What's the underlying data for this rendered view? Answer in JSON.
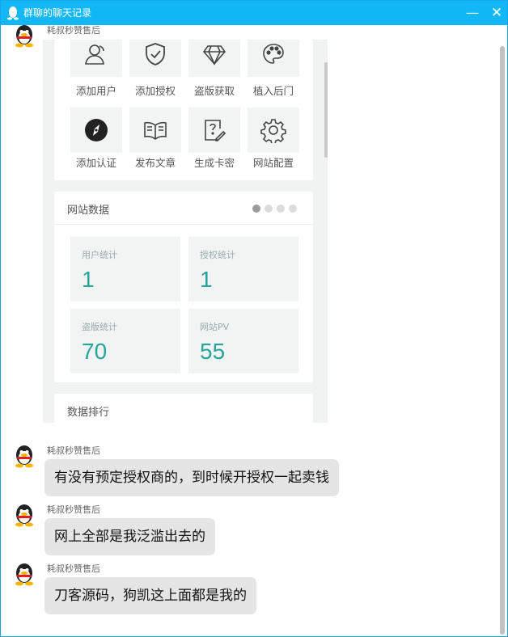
{
  "window": {
    "title": "群聊的聊天记录",
    "minimize": "—",
    "close": "✕"
  },
  "messages": [
    {
      "sender": "耗叔秒赞售后",
      "type": "image"
    },
    {
      "sender": "耗叔秒赞售后",
      "text": "有没有预定授权商的，到时候开授权一起卖钱"
    },
    {
      "sender": "耗叔秒赞售后",
      "text": "网上全部是我泛滥出去的"
    },
    {
      "sender": "耗叔秒赞售后",
      "text": "刀客源码，狗凯这上面都是我的"
    }
  ],
  "screenshot": {
    "actions": [
      {
        "label": "添加用户",
        "icon": "user-icon"
      },
      {
        "label": "添加授权",
        "icon": "shield-check-icon"
      },
      {
        "label": "盗版获取",
        "icon": "diamond-icon"
      },
      {
        "label": "植入后门",
        "icon": "palette-icon"
      },
      {
        "label": "添加认证",
        "icon": "compass-icon"
      },
      {
        "label": "发布文章",
        "icon": "book-icon"
      },
      {
        "label": "生成卡密",
        "icon": "question-edit-icon"
      },
      {
        "label": "网站配置",
        "icon": "gear-icon"
      }
    ],
    "stats_title": "网站数据",
    "carousel_pages": 4,
    "carousel_active": 1,
    "stats": [
      {
        "label": "用户统计",
        "value": "1"
      },
      {
        "label": "授权统计",
        "value": "1"
      },
      {
        "label": "盗版统计",
        "value": "70"
      },
      {
        "label": "网站PV",
        "value": "55"
      }
    ],
    "ranking_title": "数据排行"
  },
  "colors": {
    "titlebar": "#12b7f5",
    "stat_value": "#26a69a",
    "bubble": "#e5e5e5"
  }
}
